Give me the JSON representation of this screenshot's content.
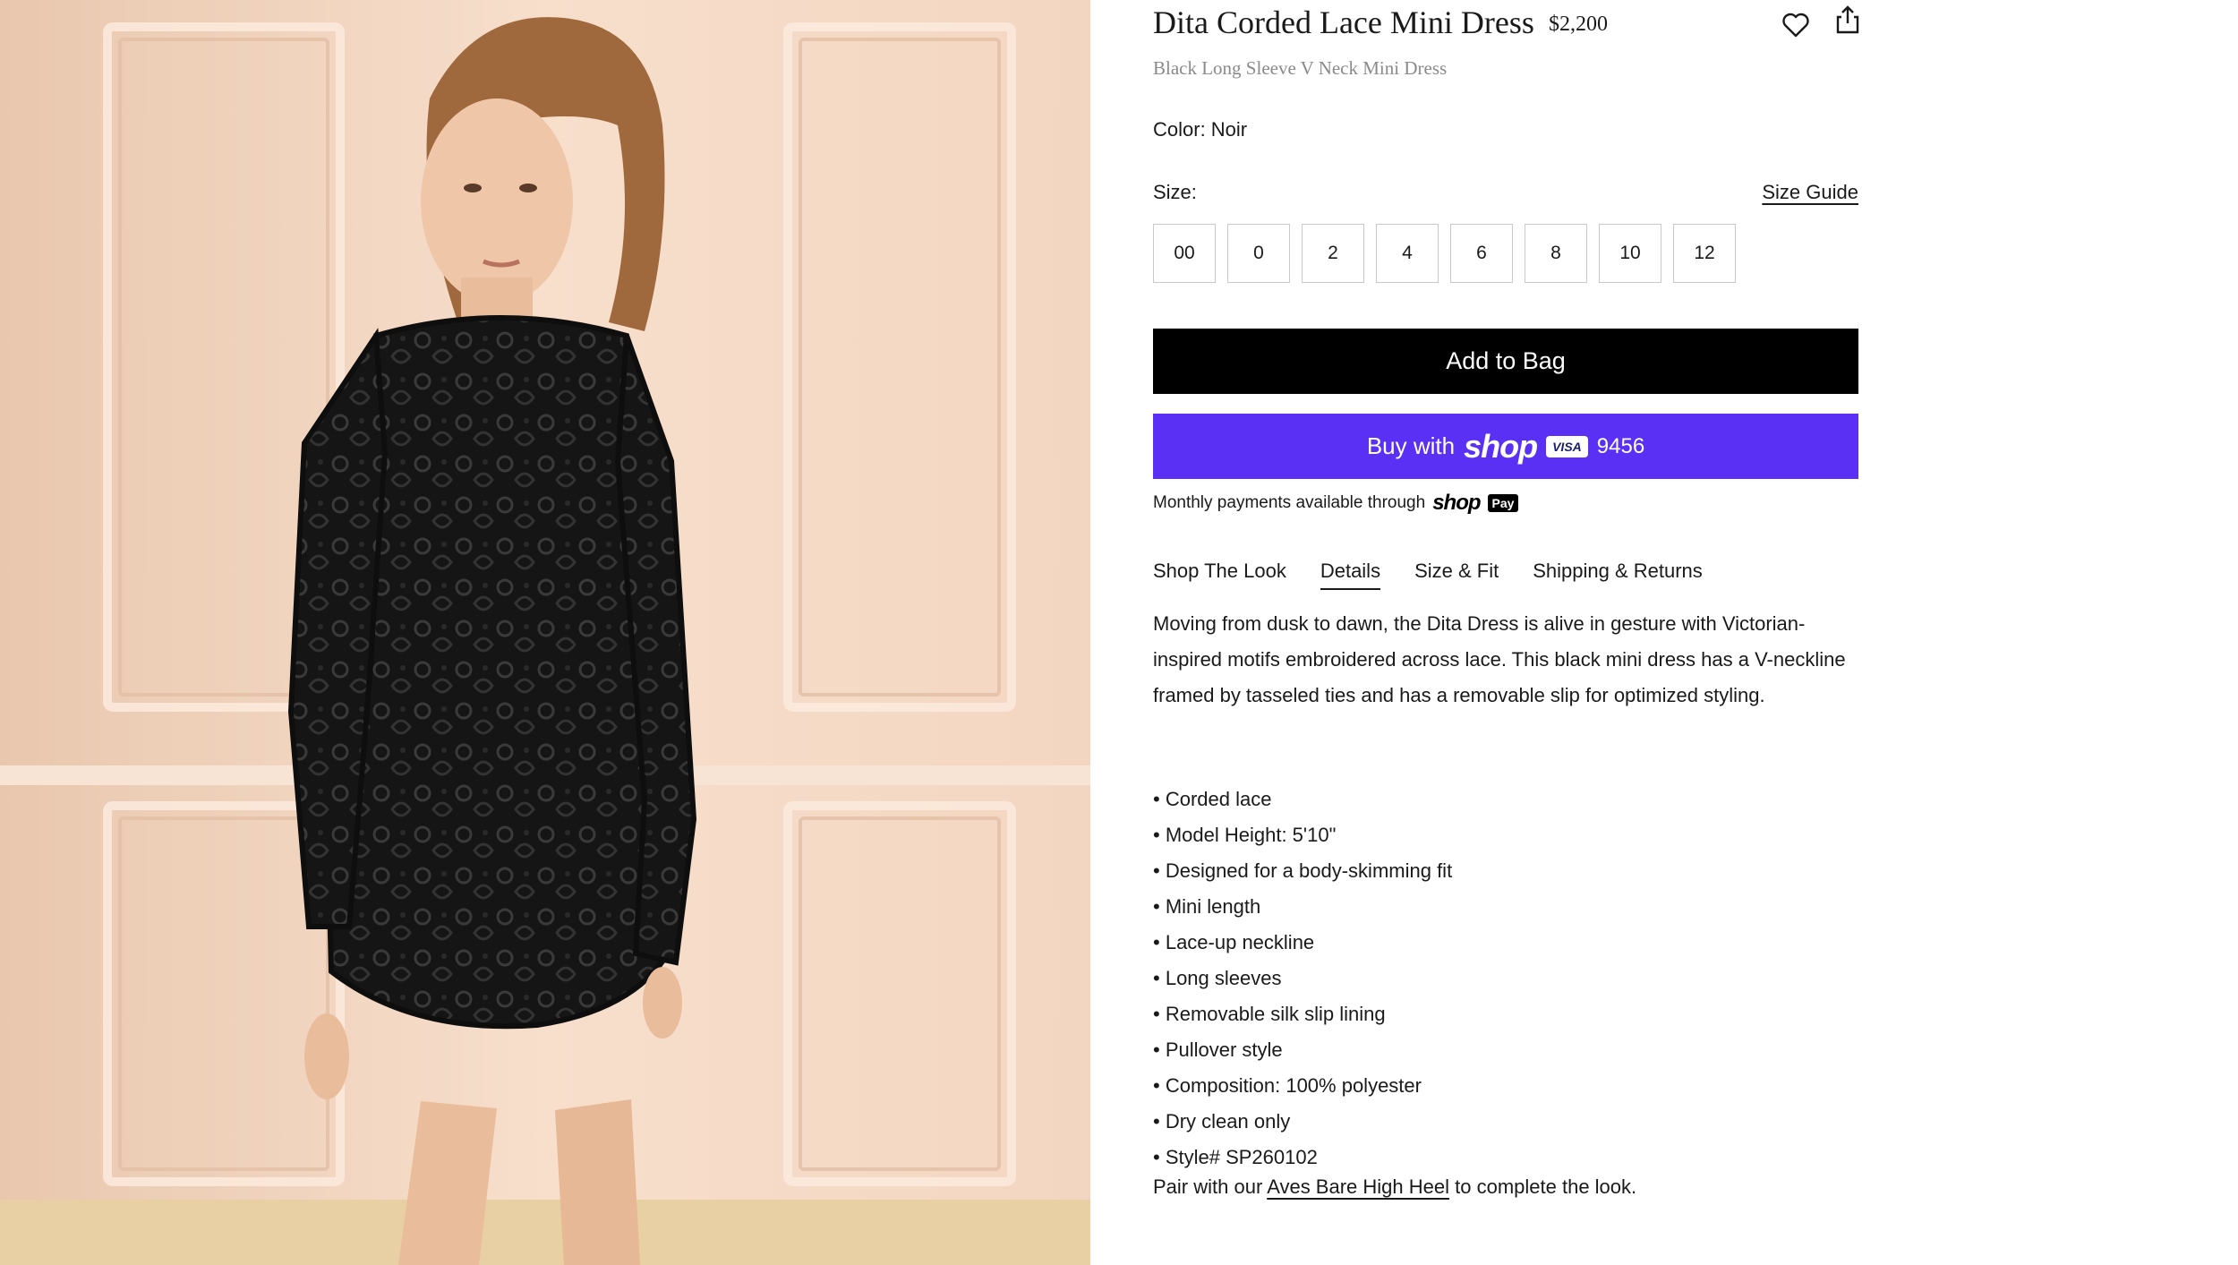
{
  "product": {
    "title": "Dita Corded Lace Mini Dress",
    "price": "$2,200",
    "subtitle": "Black Long Sleeve V Neck Mini Dress",
    "color_label": "Color: Noir",
    "size_label": "Size:",
    "size_guide": "Size Guide",
    "sizes": [
      "00",
      "0",
      "2",
      "4",
      "6",
      "8",
      "10",
      "12"
    ]
  },
  "actions": {
    "add_to_bag": "Add to Bag",
    "buy_with": "Buy with",
    "shop_word": "shop",
    "card_brand": "VISA",
    "card_last4": "9456",
    "monthly_text": "Monthly payments available through",
    "shop_pay_shop": "shop",
    "shop_pay_pay": "Pay"
  },
  "icons": {
    "favorite": "heart-icon",
    "share": "share-icon"
  },
  "tabs": [
    {
      "label": "Shop The Look",
      "active": false
    },
    {
      "label": "Details",
      "active": true
    },
    {
      "label": "Size & Fit",
      "active": false
    },
    {
      "label": "Shipping & Returns",
      "active": false
    }
  ],
  "details": {
    "description": "Moving from dusk to dawn, the Dita Dress is alive in gesture with Victorian-inspired motifs embroidered across lace. This black mini dress has a V-neckline framed by tasseled ties and has a removable slip for optimized styling.",
    "bullets": [
      "Corded lace",
      "Model Height: 5'10\"",
      "Designed for a body-skimming fit",
      "Mini length",
      "Lace-up neckline",
      "Long sleeves",
      "Removable silk slip lining",
      "Pullover style",
      "Composition: 100% polyester",
      "Dry clean only",
      "Style# SP260102"
    ],
    "pair_prefix": "Pair with our",
    "pair_link": "Aves Bare High Heel",
    "pair_suffix": "to complete the look."
  },
  "colors": {
    "accent_black": "#000000",
    "shop_pay_purple": "#5a31f4",
    "wall": "#f4d9c4"
  }
}
